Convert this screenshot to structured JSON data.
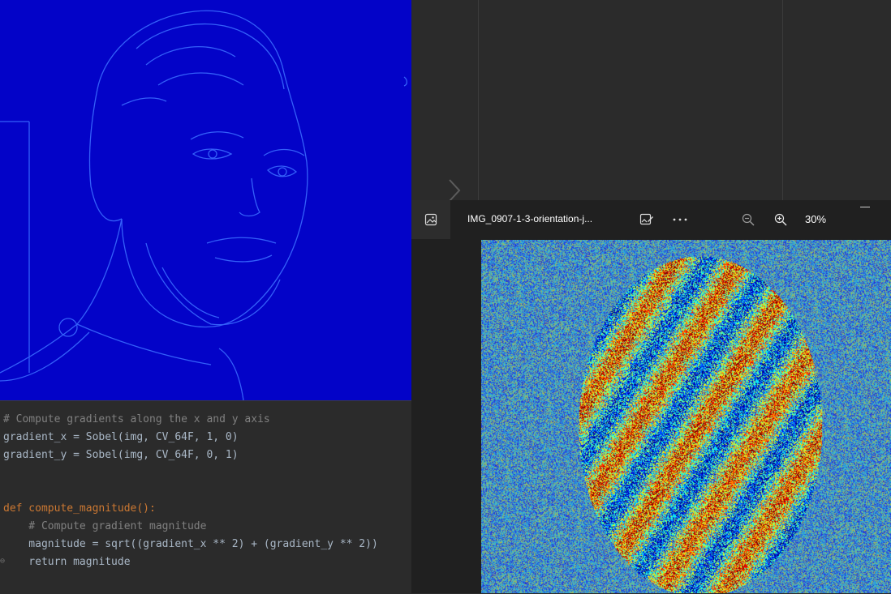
{
  "viewer": {
    "filename": "IMG_0907-1-3-orientation-j...",
    "zoom_level": "30%",
    "icons": {
      "app": "image-icon",
      "edit": "edit-image-icon",
      "more": "more-options-icon",
      "zoom_out": "zoom-out-icon",
      "zoom_in": "zoom-in-icon",
      "minimize": "minimize-icon"
    }
  },
  "editor": {
    "lines": [
      {
        "text": "# Compute gradients along the x and y axis"
      },
      {
        "text": "gradient_x = Sobel(img, CV_64F, 1, 0)"
      },
      {
        "text": "gradient_y = Sobel(img, CV_64F, 0, 1)"
      },
      {
        "text": "def compute_magnitude():"
      },
      {
        "text": "    # Compute gradient magnitude"
      },
      {
        "text": "    magnitude = sqrt((gradient_x ** 2) + (gradient_y ** 2))"
      },
      {
        "text": "    return magnitude"
      }
    ]
  },
  "colors": {
    "editor_bg": "#2b2b2b",
    "keyword": "#cc7832",
    "function": "#ffc66d",
    "comment": "#808080",
    "number": "#6897bb",
    "magnitude_bg": "#0303c8"
  }
}
